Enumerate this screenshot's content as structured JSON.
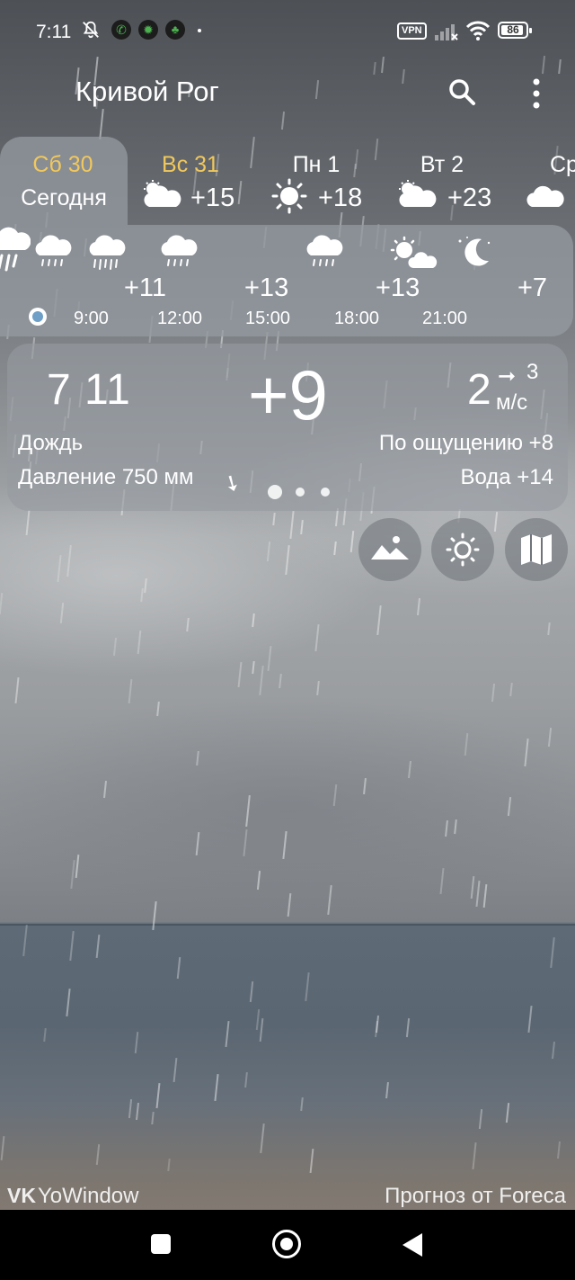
{
  "status_bar": {
    "time": "7:11",
    "vpn": "VPN",
    "battery": "86"
  },
  "app_bar": {
    "city": "Кривой Рог"
  },
  "days": [
    {
      "name": "Сб 30",
      "label": "Сегодня",
      "selected": true
    },
    {
      "name": "Вс 31",
      "temp": "+15",
      "icon": "partly-cloudy-icon"
    },
    {
      "name": "Пн 1",
      "temp": "+18",
      "icon": "sun-icon"
    },
    {
      "name": "Вт 2",
      "temp": "+23",
      "icon": "partly-cloudy-icon"
    },
    {
      "name": "Ср",
      "icon": "cloud-icon"
    }
  ],
  "hourly": {
    "temps": [
      "+11",
      "+13",
      "+13",
      "+7"
    ],
    "times": [
      "9:00",
      "12:00",
      "15:00",
      "18:00",
      "21:00"
    ],
    "icons": [
      "heavy-rain-icon",
      "rain-icon",
      "heavy-rain-icon",
      "rain-icon",
      "rain-icon",
      "partly-cloudy-icon",
      "moon-icon"
    ]
  },
  "current": {
    "time": "7 11",
    "temperature": "+9",
    "wind_speed": "2",
    "wind_gust": "3",
    "wind_unit": "м/с",
    "condition": "Дождь",
    "feels_like": "По ощущению +8",
    "pressure": "Давление 750 мм",
    "water": "Вода +14",
    "pager_count": 3,
    "pager_active": 0
  },
  "footer": {
    "brand": "YoWindow",
    "brand_mark": "VK",
    "credit": "Прогноз от Foreca"
  },
  "colors": {
    "accent_gold": "#f1c85b",
    "panel": "#969ba2",
    "now_marker": "#6f9fc6"
  }
}
